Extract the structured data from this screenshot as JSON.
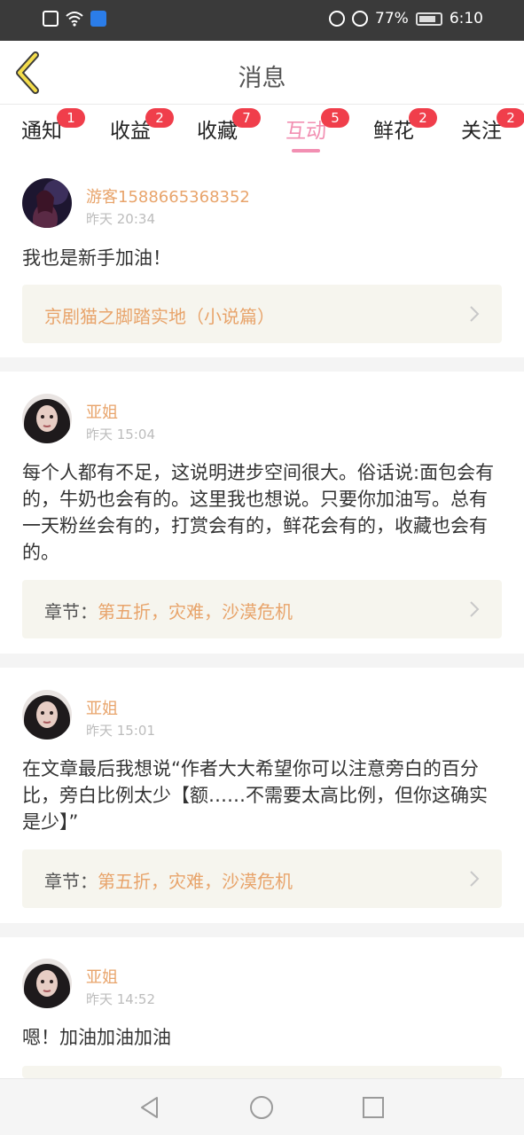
{
  "status_bar": {
    "battery": "77%",
    "time": "6:10",
    "icons": [
      "sim-alert-icon",
      "wifi-icon",
      "app-notification-icon",
      "vibrate-icon",
      "alarm-icon",
      "battery-icon"
    ]
  },
  "header": {
    "title": "消息",
    "back_icon": "back-chevron-icon"
  },
  "tabs": [
    {
      "label": "通知",
      "badge": "1",
      "active": false
    },
    {
      "label": "收益",
      "badge": "2",
      "active": false
    },
    {
      "label": "收藏",
      "badge": "7",
      "active": false
    },
    {
      "label": "互动",
      "badge": "5",
      "active": true
    },
    {
      "label": "鲜花",
      "badge": "2",
      "active": false
    },
    {
      "label": "关注",
      "badge": "2",
      "active": false
    }
  ],
  "messages": [
    {
      "username": "游客1588665368352",
      "time": "昨天 20:34",
      "content": "我也是新手加油！",
      "ref_prefix": "",
      "ref_text": "京剧猫之脚踏实地（小说篇）"
    },
    {
      "username": "亚姐",
      "time": "昨天 15:04",
      "content": "每个人都有不足，这说明进步空间很大。俗话说:面包会有的，牛奶也会有的。这里我也想说。只要你加油写。总有一天粉丝会有的，打赏会有的，鲜花会有的，收藏也会有的。",
      "ref_prefix": "章节：",
      "ref_text": "第五折，灾难，沙漠危机"
    },
    {
      "username": "亚姐",
      "time": "昨天 15:01",
      "content": "在文章最后我想说“作者大大希望你可以注意旁白的百分比，旁白比例太少【额……不需要太高比例，但你这确实是少】”",
      "ref_prefix": "章节：",
      "ref_text": "第五折，灾难，沙漠危机"
    },
    {
      "username": "亚姐",
      "time": "昨天 14:52",
      "content": "嗯！加油加油加油"
    }
  ],
  "colors": {
    "accent_pink": "#f28fb2",
    "username_orange": "#e8a46b",
    "badge_red": "#f03e4b",
    "ref_bg": "#f6f5ee"
  }
}
